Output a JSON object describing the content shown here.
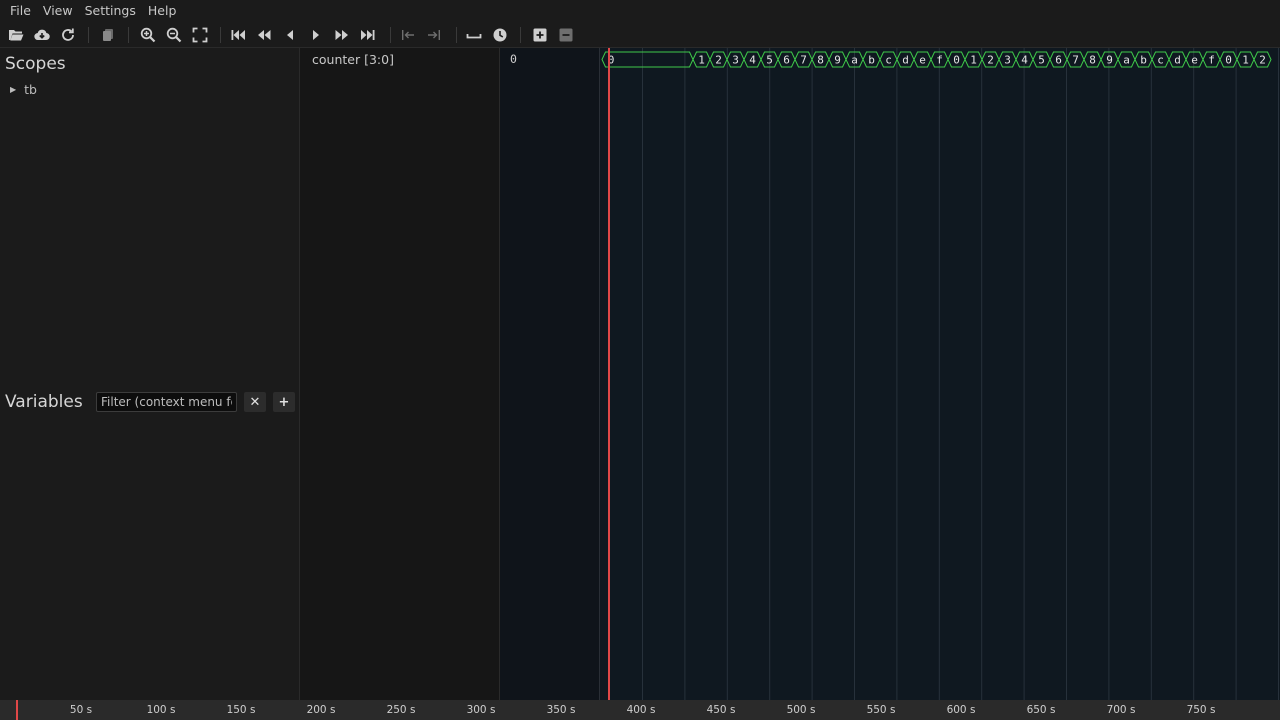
{
  "menu": [
    "File",
    "View",
    "Settings",
    "Help"
  ],
  "toolbar": {
    "buttons": [
      {
        "name": "open-file-button",
        "icon": "folder-open-icon"
      },
      {
        "name": "open-url-button",
        "icon": "cloud-download-icon"
      },
      {
        "name": "reload-button",
        "icon": "reload-icon"
      },
      {
        "name": "copy-button",
        "icon": "copy-icon"
      },
      {
        "name": "zoom-in-button",
        "icon": "zoom-in-icon"
      },
      {
        "name": "zoom-out-button",
        "icon": "zoom-out-icon"
      },
      {
        "name": "zoom-fit-button",
        "icon": "fullscreen-icon"
      },
      {
        "name": "go-to-start-button",
        "icon": "skip-start-icon"
      },
      {
        "name": "scroll-left-fast-button",
        "icon": "fast-rewind-icon"
      },
      {
        "name": "scroll-left-button",
        "icon": "step-back-icon"
      },
      {
        "name": "scroll-right-button",
        "icon": "play-icon"
      },
      {
        "name": "scroll-right-fast-button",
        "icon": "fast-forward-icon"
      },
      {
        "name": "go-to-end-button",
        "icon": "skip-end-icon"
      },
      {
        "name": "prev-transition-button",
        "icon": "prev-transition-icon"
      },
      {
        "name": "next-transition-button",
        "icon": "next-transition-icon"
      },
      {
        "name": "toggle-space-button",
        "icon": "space-icon"
      },
      {
        "name": "time-button",
        "icon": "clock-icon"
      },
      {
        "name": "add-marker-button",
        "icon": "plus-box-icon"
      },
      {
        "name": "remove-marker-button",
        "icon": "minus-box-icon"
      }
    ]
  },
  "scopes": {
    "title": "Scopes",
    "items": [
      {
        "label": "tb"
      }
    ]
  },
  "variables": {
    "title": "Variables",
    "filter_placeholder": "Filter (context menu for",
    "clear_label": "✕",
    "add_label": "+"
  },
  "signals": [
    {
      "name": "counter [3:0]",
      "value": "0"
    }
  ],
  "waveform": {
    "values": [
      "0",
      "1",
      "2",
      "3",
      "4",
      "5",
      "6",
      "7",
      "8",
      "9",
      "a",
      "b",
      "c",
      "d",
      "e",
      "f",
      "0",
      "1",
      "2",
      "3",
      "4",
      "5",
      "6",
      "7",
      "8",
      "9",
      "a",
      "b",
      "c",
      "d",
      "e",
      "f",
      "0",
      "1",
      "2"
    ],
    "color": "#3fc94a",
    "cursor_color": "#e04848"
  },
  "timeline": {
    "ticks": [
      "50 s",
      "100 s",
      "150 s",
      "200 s",
      "250 s",
      "300 s",
      "350 s",
      "400 s",
      "450 s",
      "500 s",
      "550 s",
      "600 s",
      "650 s",
      "700 s",
      "750 s"
    ]
  }
}
